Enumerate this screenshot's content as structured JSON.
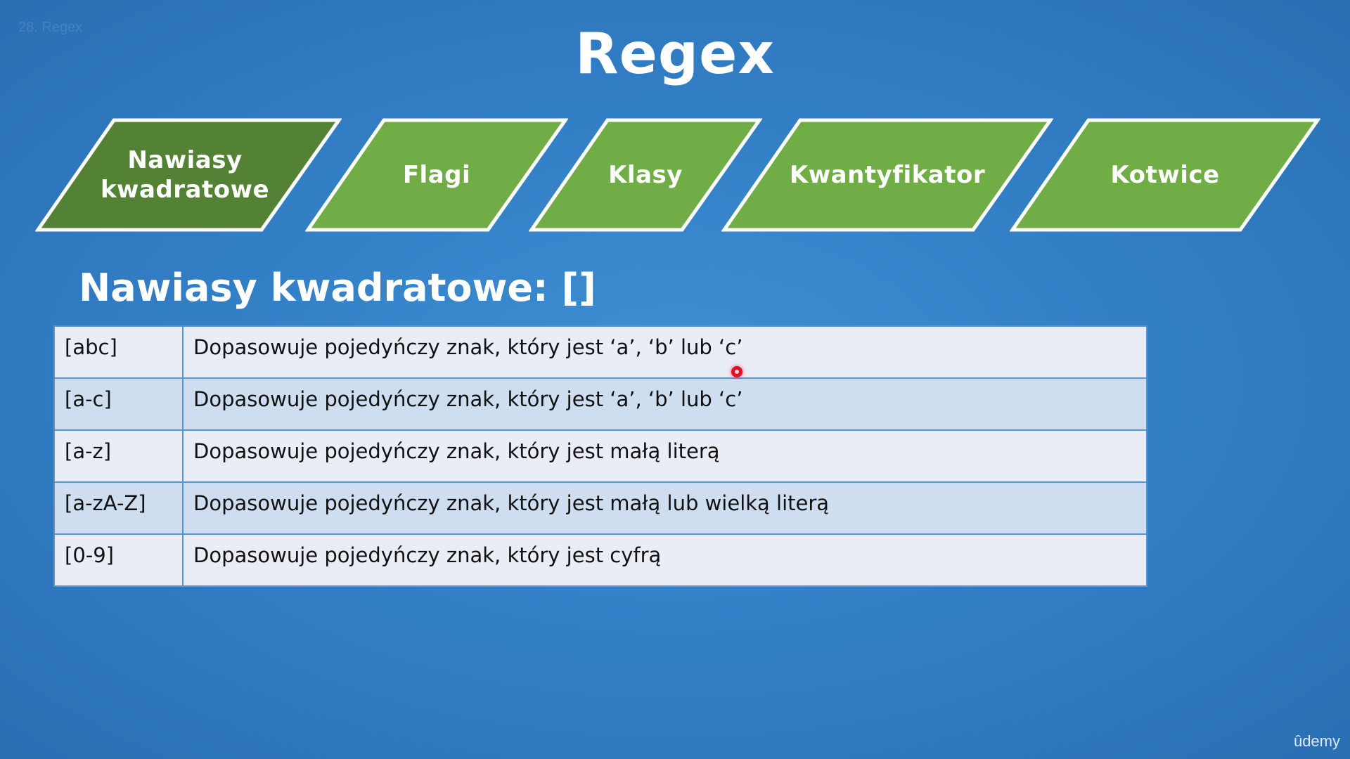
{
  "lecture_label": "28. Regex",
  "title": "Regex",
  "tabs": [
    {
      "label": "Nawiasy kwadratowe",
      "active": true
    },
    {
      "label": "Flagi",
      "active": false
    },
    {
      "label": "Klasy",
      "active": false
    },
    {
      "label": "Kwantyfikator",
      "active": false
    },
    {
      "label": "Kotwice",
      "active": false
    }
  ],
  "colors": {
    "tab_active": "#548235",
    "tab_inactive": "#70ad47",
    "tab_border": "#ffffff",
    "background": "#3380c7"
  },
  "section_heading": "Nawiasy kwadratowe: []",
  "table": {
    "rows": [
      {
        "pattern": "[abc]",
        "description": "Dopasowuje pojedyńczy znak, który jest ‘a’, ‘b’ lub ‘c’"
      },
      {
        "pattern": "[a-c]",
        "description": "Dopasowuje pojedyńczy znak, który jest ‘a’, ‘b’ lub ‘c’"
      },
      {
        "pattern": "[a-z]",
        "description": "Dopasowuje pojedyńczy znak, który jest małą literą"
      },
      {
        "pattern": "[a-zA-Z]",
        "description": "Dopasowuje pojedyńczy znak, który jest małą lub wielką literą"
      },
      {
        "pattern": "[0-9]",
        "description": "Dopasowuje pojedyńczy znak, który jest cyfrą"
      }
    ]
  },
  "brand": "ûdemy"
}
